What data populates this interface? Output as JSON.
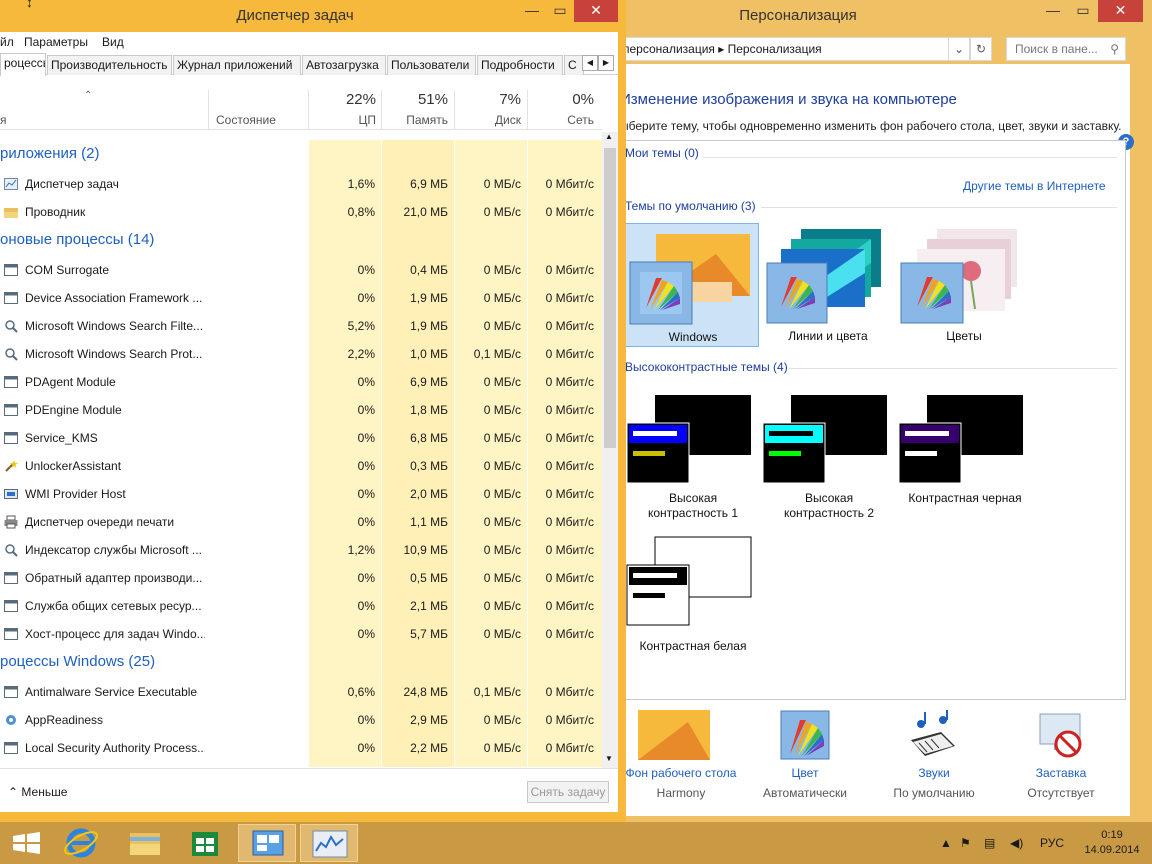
{
  "personalization": {
    "title": "Персонализация",
    "breadcrumb": [
      "персонализация",
      "Персонализация"
    ],
    "search_placeholder": "Поиск в пане...",
    "heading": "Изменение изображения и звука на компьютере",
    "subtitle": "ыберите тему, чтобы одновременно изменить фон рабочего стола, цвет, звуки и заставку.",
    "my_themes": "Мои темы (0)",
    "more_themes_link": "Другие темы в Интернете",
    "default_themes": "Темы по умолчанию (3)",
    "default_list": [
      {
        "label": "Windows"
      },
      {
        "label": "Линии и цвета"
      },
      {
        "label": "Цветы"
      }
    ],
    "hc_themes": "Высококонтрастные темы (4)",
    "hc_list": [
      {
        "line1": "Высокая",
        "line2": "контрастность 1",
        "bar1": "#ffffff",
        "bar2": "#c8c000",
        "headbg": "#0000ff"
      },
      {
        "line1": "Высокая",
        "line2": "контрастность 2",
        "bar1": "#000000",
        "bar2": "#00ff00",
        "headbg": "#00ffff"
      },
      {
        "line1": "Контрастная черная",
        "line2": "",
        "bar1": "#ffffff",
        "bar2": "#ffffff",
        "headbg": "#37006e"
      },
      {
        "line1": "Контрастная белая",
        "line2": "",
        "bar1": "#ffffff",
        "bar2": "#000000",
        "headbg": "#000000"
      }
    ],
    "bottom": [
      {
        "name": "Фон рабочего стола",
        "value": "Harmony"
      },
      {
        "name": "Цвет",
        "value": "Автоматически"
      },
      {
        "name": "Звуки",
        "value": "По умолчанию"
      },
      {
        "name": "Заставка",
        "value": "Отсутствует"
      }
    ]
  },
  "taskmanager": {
    "title": "Диспетчер задач",
    "menu": [
      "йл",
      "Параметры",
      "Вид"
    ],
    "tabs": [
      "роцессы",
      "Производительность",
      "Журнал приложений",
      "Автозагрузка",
      "Пользователи",
      "Подробности",
      "С"
    ],
    "columns": {
      "name": "я",
      "status": "Состояние",
      "cpu_pct": "22%",
      "cpu": "ЦП",
      "mem_pct": "51%",
      "mem": "Память",
      "disk_pct": "7%",
      "disk": "Диск",
      "net_pct": "0%",
      "net": "Сеть"
    },
    "groups": [
      {
        "title": "риложения (2)",
        "rows": [
          {
            "name": "Диспетчер задач",
            "cpu": "1,6%",
            "mem": "6,9 МБ",
            "disk": "0 МБ/с",
            "net": "0 Мбит/с",
            "icon": "task-manager-icon"
          },
          {
            "name": "Проводник",
            "cpu": "0,8%",
            "mem": "21,0 МБ",
            "disk": "0 МБ/с",
            "net": "0 Мбит/с",
            "icon": "folder-icon"
          }
        ]
      },
      {
        "title": "оновые процессы (14)",
        "rows": [
          {
            "name": "COM Surrogate",
            "cpu": "0%",
            "mem": "0,4 МБ",
            "disk": "0 МБ/с",
            "net": "0 Мбит/с",
            "icon": "window-icon"
          },
          {
            "name": "Device Association Framework ...",
            "cpu": "0%",
            "mem": "1,9 МБ",
            "disk": "0 МБ/с",
            "net": "0 Мбит/с",
            "icon": "window-icon"
          },
          {
            "name": "Microsoft Windows Search Filte...",
            "cpu": "5,2%",
            "mem": "1,9 МБ",
            "disk": "0 МБ/с",
            "net": "0 Мбит/с",
            "icon": "search-user-icon"
          },
          {
            "name": "Microsoft Windows Search Prot...",
            "cpu": "2,2%",
            "mem": "1,0 МБ",
            "disk": "0,1 МБ/с",
            "net": "0 Мбит/с",
            "icon": "search-user-icon"
          },
          {
            "name": "PDAgent Module",
            "cpu": "0%",
            "mem": "6,9 МБ",
            "disk": "0 МБ/с",
            "net": "0 Мбит/с",
            "icon": "window-icon"
          },
          {
            "name": "PDEngine Module",
            "cpu": "0%",
            "mem": "1,8 МБ",
            "disk": "0 МБ/с",
            "net": "0 Мбит/с",
            "icon": "window-icon"
          },
          {
            "name": "Service_KMS",
            "cpu": "0%",
            "mem": "6,8 МБ",
            "disk": "0 МБ/с",
            "net": "0 Мбит/с",
            "icon": "window-icon"
          },
          {
            "name": "UnlockerAssistant",
            "cpu": "0%",
            "mem": "0,3 МБ",
            "disk": "0 МБ/с",
            "net": "0 Мбит/с",
            "icon": "wand-icon"
          },
          {
            "name": "WMI Provider Host",
            "cpu": "0%",
            "mem": "2,0 МБ",
            "disk": "0 МБ/с",
            "net": "0 Мбит/с",
            "icon": "wmi-icon"
          },
          {
            "name": "Диспетчер очереди печати",
            "cpu": "0%",
            "mem": "1,1 МБ",
            "disk": "0 МБ/с",
            "net": "0 Мбит/с",
            "icon": "printer-icon"
          },
          {
            "name": "Индексатор службы Microsoft ...",
            "cpu": "1,2%",
            "mem": "10,9 МБ",
            "disk": "0 МБ/с",
            "net": "0 Мбит/с",
            "icon": "search-user-icon"
          },
          {
            "name": "Обратный адаптер производи...",
            "cpu": "0%",
            "mem": "0,5 МБ",
            "disk": "0 МБ/с",
            "net": "0 Мбит/с",
            "icon": "window-icon"
          },
          {
            "name": "Служба общих сетевых ресур...",
            "cpu": "0%",
            "mem": "2,1 МБ",
            "disk": "0 МБ/с",
            "net": "0 Мбит/с",
            "icon": "window-icon"
          },
          {
            "name": "Хост-процесс для задач Windo...",
            "cpu": "0%",
            "mem": "5,7 МБ",
            "disk": "0 МБ/с",
            "net": "0 Мбит/с",
            "icon": "window-icon"
          }
        ]
      },
      {
        "title": "роцессы Windows (25)",
        "rows": [
          {
            "name": "Antimalware Service Executable",
            "cpu": "0,6%",
            "mem": "24,8 МБ",
            "disk": "0,1 МБ/с",
            "net": "0 Мбит/с",
            "icon": "window-icon"
          },
          {
            "name": "AppReadiness",
            "cpu": "0%",
            "mem": "2,9 МБ",
            "disk": "0 МБ/с",
            "net": "0 Мбит/с",
            "icon": "gear-icon"
          },
          {
            "name": "Local Security Authority Process...",
            "cpu": "0%",
            "mem": "2,2 МБ",
            "disk": "0 МБ/с",
            "net": "0 Мбит/с",
            "icon": "window-icon"
          }
        ]
      }
    ],
    "less_label": "Меньше",
    "end_task_label": "Снять задачу"
  },
  "taskbar": {
    "lang": "РУС",
    "time": "0:19",
    "date": "14.09.2014"
  }
}
